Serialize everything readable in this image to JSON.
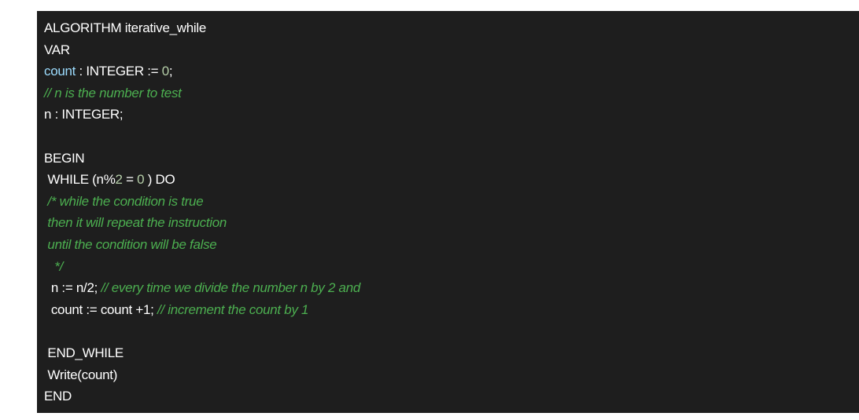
{
  "code": {
    "l1": "ALGORITHM iterative_while",
    "l2": "VAR",
    "l3_var": "count",
    "l3_mid": " : INTEGER := ",
    "l3_num": "0",
    "l3_end": ";",
    "l4_comment": "// n is the number to test",
    "l5": "n : INTEGER;",
    "l6": "",
    "l7": "BEGIN",
    "l8_a": " WHILE (n%",
    "l8_num1": "2",
    "l8_b": " = ",
    "l8_num2": "0",
    "l8_c": " ) DO",
    "l9_comment": " /* while the condition is true",
    "l10_comment": " then it will repeat the instruction",
    "l11_comment": " until the condition will be false",
    "l12_comment": "   */",
    "l13_code": "  n := n/2; ",
    "l13_comment": "// every time we divide the number n by 2 and",
    "l14_code": "  count := count +1; ",
    "l14_comment": "// increment the count by 1",
    "l15": "",
    "l16": " END_WHILE",
    "l17": " Write(count)",
    "l18": "END"
  },
  "colors": {
    "background": "#1e1e1e",
    "text": "#ffffff",
    "variable": "#9cdcfe",
    "number": "#b5cea8",
    "comment": "#4caf50"
  }
}
